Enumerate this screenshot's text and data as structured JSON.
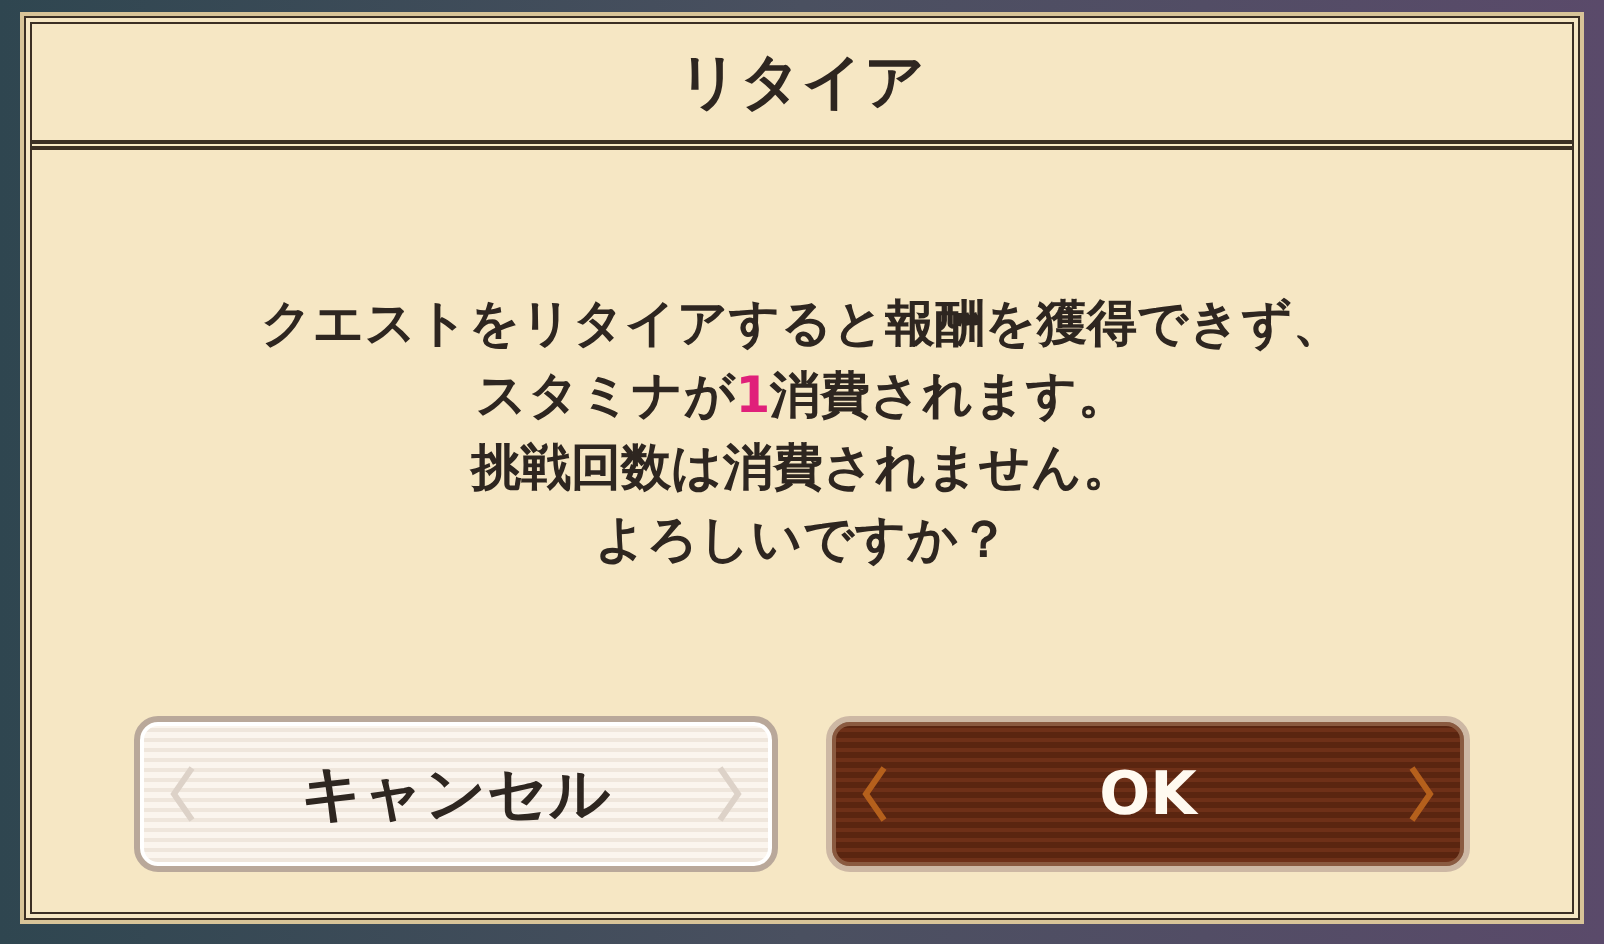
{
  "dialog": {
    "title": "リタイア",
    "message": [
      "クエストをリタイアすると報酬を獲得できず、",
      "スタミナが**1**消費されます。",
      "挑戦回数は消費されません。",
      "よろしいですか？"
    ],
    "buttons": [
      {
        "label": "キャンセル",
        "kind": "secondary"
      },
      {
        "label": "OK",
        "kind": "primary"
      }
    ]
  }
}
